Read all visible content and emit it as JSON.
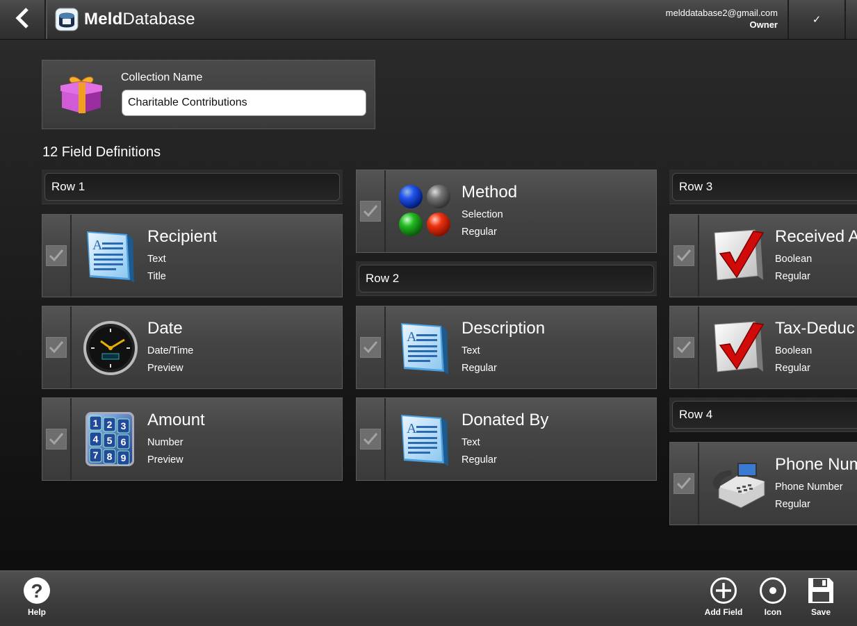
{
  "header": {
    "back_icon": "chevron-left-icon",
    "logo_icon": "meld-database-logo",
    "title_bold": "Meld",
    "title_regular": "Database",
    "account_email": "melddatabase2@gmail.com",
    "account_role": "Owner",
    "confirm_label": "✓"
  },
  "collection": {
    "icon": "gift-icon",
    "label": "Collection Name",
    "value": "Charitable Contributions"
  },
  "field_count_label": "12 Field Definitions",
  "rows": [
    {
      "label": "Row 1"
    },
    {
      "label": "Row 2"
    },
    {
      "label": "Row 3"
    },
    {
      "label": "Row 4"
    }
  ],
  "fields": [
    {
      "name": "Recipient",
      "type": "Text",
      "style": "Title",
      "icon": "text-document-icon",
      "checked": true
    },
    {
      "name": "Date",
      "type": "Date/Time",
      "style": "Preview",
      "icon": "clock-icon",
      "checked": true
    },
    {
      "name": "Amount",
      "type": "Number",
      "style": "Preview",
      "icon": "number-keypad-icon",
      "checked": true
    },
    {
      "name": "Method",
      "type": "Selection",
      "style": "Regular",
      "icon": "selection-balls-icon",
      "checked": true
    },
    {
      "name": "Description",
      "type": "Text",
      "style": "Regular",
      "icon": "text-document-icon",
      "checked": true
    },
    {
      "name": "Donated By",
      "type": "Text",
      "style": "Regular",
      "icon": "text-document-icon",
      "checked": true
    },
    {
      "name": "Received A",
      "type": "Boolean",
      "style": "Regular",
      "icon": "checkmark-box-icon",
      "checked": true
    },
    {
      "name": "Tax-Deduc",
      "type": "Boolean",
      "style": "Regular",
      "icon": "checkmark-box-icon",
      "checked": true
    },
    {
      "name": "Phone Num",
      "type": "Phone Number",
      "style": "Regular",
      "icon": "telephone-icon",
      "checked": true
    }
  ],
  "toolbar": {
    "help": {
      "label": "Help",
      "icon": "help-icon"
    },
    "add_field": {
      "label": "Add Field",
      "icon": "add-circle-icon"
    },
    "icon": {
      "label": "Icon",
      "icon": "target-circle-icon"
    },
    "save": {
      "label": "Save",
      "icon": "floppy-disk-icon"
    }
  }
}
